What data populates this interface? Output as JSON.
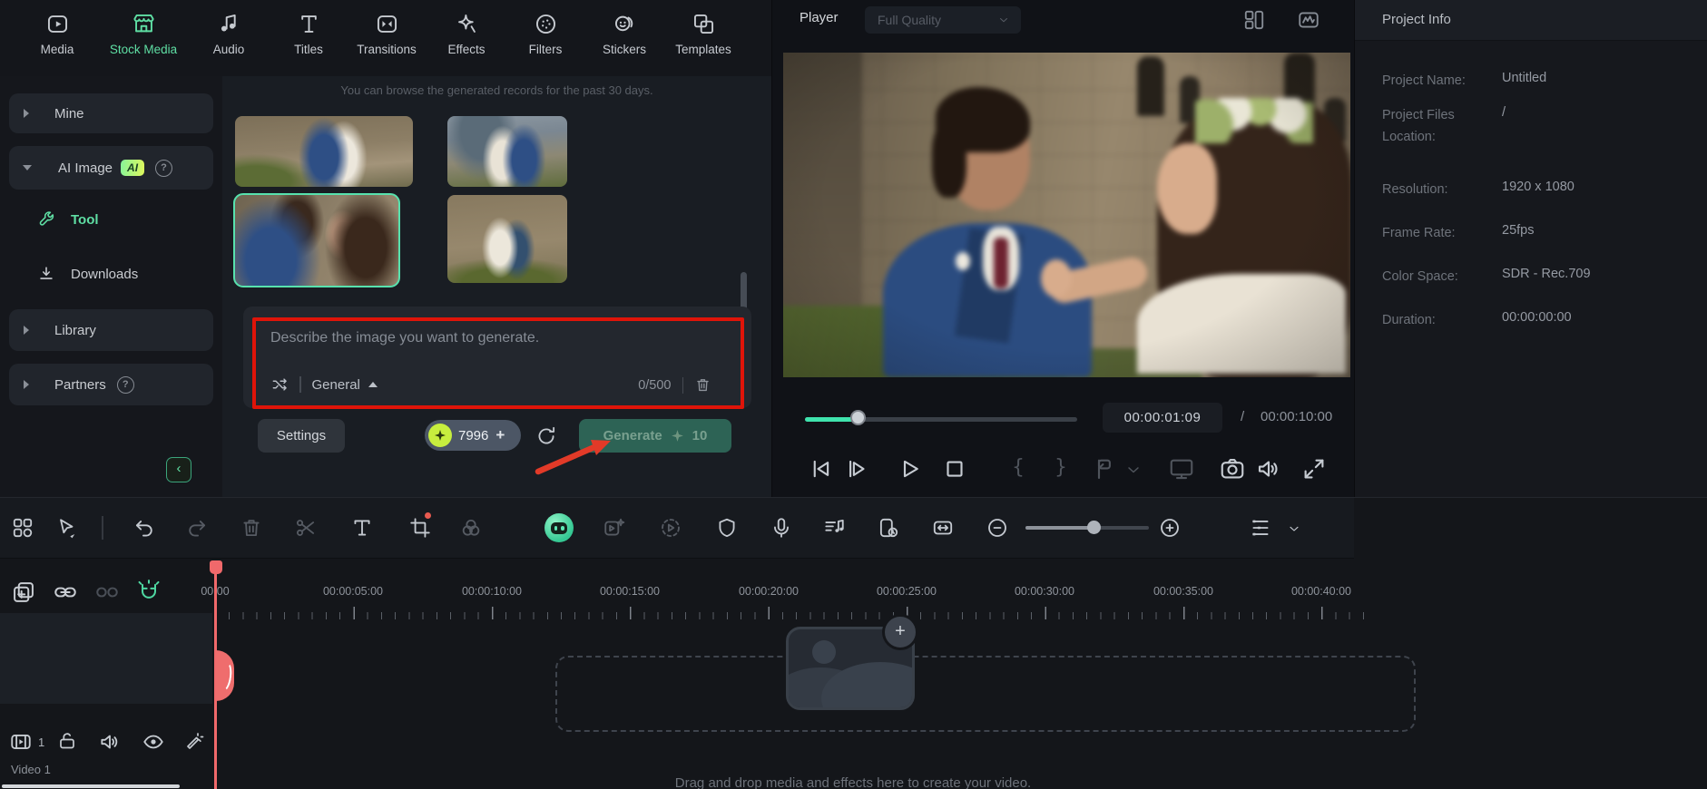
{
  "nav": {
    "items": [
      {
        "label": "Media"
      },
      {
        "label": "Stock Media"
      },
      {
        "label": "Audio"
      },
      {
        "label": "Titles"
      },
      {
        "label": "Transitions"
      },
      {
        "label": "Effects"
      },
      {
        "label": "Filters"
      },
      {
        "label": "Stickers"
      },
      {
        "label": "Templates"
      }
    ]
  },
  "sidebar": {
    "mine": "Mine",
    "ai_image": "AI Image",
    "ai_badge": "AI",
    "tool": "Tool",
    "downloads": "Downloads",
    "library": "Library",
    "partners": "Partners"
  },
  "stock": {
    "notice": "You can browse the generated records for the past 30 days.",
    "prompt": {
      "placeholder": "Describe the image you want to generate.",
      "style": "General",
      "char_count": "0/500"
    },
    "settings": "Settings",
    "credits": "7996",
    "credits_add": "+",
    "generate": "Generate",
    "generate_cost": "10"
  },
  "player": {
    "title": "Player",
    "quality": "Full Quality",
    "current_time": "00:00:01:09",
    "slash": "/",
    "total_time": "00:00:10:00"
  },
  "project": {
    "title": "Project Info",
    "rows": [
      {
        "label": "Project Name:",
        "value": "Untitled"
      },
      {
        "label": "Project Files Location:",
        "value": "/"
      },
      {
        "label": "Resolution:",
        "value": "1920 x 1080"
      },
      {
        "label": "Frame Rate:",
        "value": "25fps"
      },
      {
        "label": "Color Space:",
        "value": "SDR - Rec.709"
      },
      {
        "label": "Duration:",
        "value": "00:00:00:00"
      }
    ]
  },
  "timeline": {
    "ruler": [
      "00:00",
      "00:00:05:00",
      "00:00:10:00",
      "00:00:15:00",
      "00:00:20:00",
      "00:00:25:00",
      "00:00:30:00",
      "00:00:35:00",
      "00:00:40:00"
    ],
    "drop_hint": "Drag and drop media and effects here to create your video.",
    "track_name": "Video 1",
    "track_number": "1"
  },
  "colors": {
    "accent_teal": "#5fdfa4",
    "annotation_red": "#df1409",
    "playhead_red": "#f0696b",
    "ai_badge_from": "#86f59a",
    "ai_badge_to": "#dff75c",
    "generate_bg": "#2d6355",
    "coin_yellow": "#c7ee3e"
  }
}
